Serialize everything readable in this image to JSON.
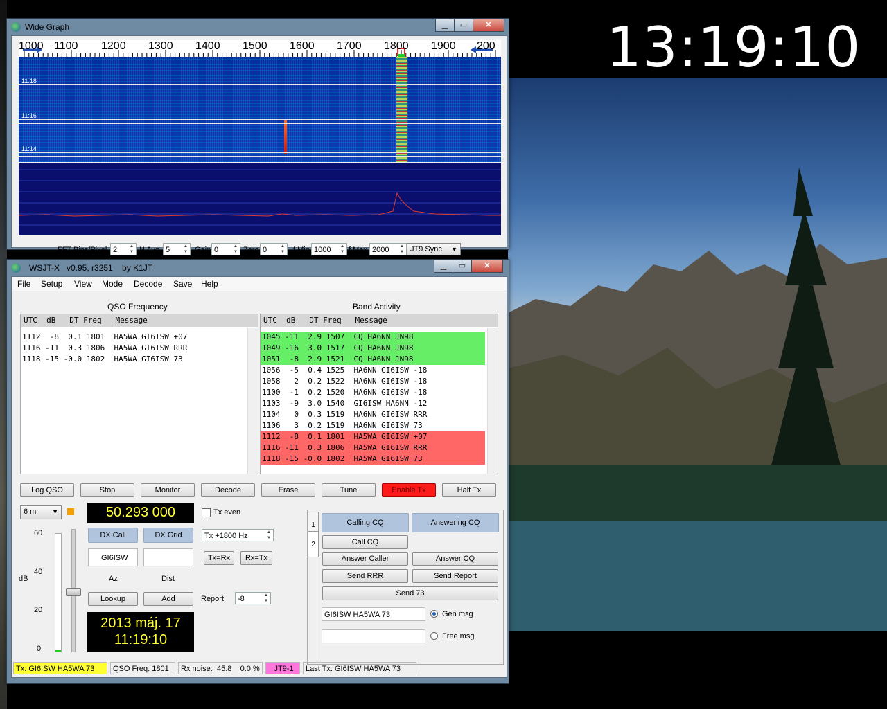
{
  "desktop": {
    "clock": "13:19:10"
  },
  "wide_graph": {
    "title": "Wide Graph",
    "freq_ticks": [
      "1000",
      "1100",
      "1200",
      "1300",
      "1400",
      "1500",
      "1600",
      "1700",
      "1800",
      "1900",
      "200"
    ],
    "wf_times": [
      "11:18",
      "11:16",
      "11:14"
    ],
    "controls": {
      "fft_label": "FFT Bins/Pixel",
      "fft_value": "2",
      "navg_label": "N Avg",
      "navg_value": "5",
      "gain_label": "Gain",
      "gain_value": "0",
      "zero_label": "Zero",
      "zero_value": "0",
      "fmin_label": "f Min",
      "fmin_value": "1000",
      "fmax_label": "f Max",
      "fmax_value": "2000",
      "mode_select": "JT9 Sync"
    }
  },
  "main": {
    "title": "WSJT-X   v0.95, r3251    by K1JT",
    "menu": [
      "File",
      "Setup",
      "View",
      "Mode",
      "Decode",
      "Save",
      "Help"
    ],
    "qso_title": "QSO Frequency",
    "band_title": "Band Activity",
    "list_header": "UTC  dB   DT Freq   Message",
    "qso_rows": [
      "1112  -8  0.1 1801  HA5WA GI6ISW +07",
      "1116 -11  0.3 1806  HA5WA GI6ISW RRR",
      "1118 -15 -0.0 1802  HA5WA GI6ISW 73"
    ],
    "band_rows": [
      {
        "text": "1045 -11  2.9 1507  CQ HA6NN JN98",
        "color": "#66ee66"
      },
      {
        "text": "1049 -16  3.0 1517  CQ HA6NN JN98",
        "color": "#66ee66"
      },
      {
        "text": "1051  -8  2.9 1521  CQ HA6NN JN98",
        "color": "#66ee66"
      },
      {
        "text": "1056  -5  0.4 1525  HA6NN GI6ISW -18",
        "color": "#ffffff"
      },
      {
        "text": "1058   2  0.2 1522  HA6NN GI6ISW -18",
        "color": "#ffffff"
      },
      {
        "text": "1100  -1  0.2 1520  HA6NN GI6ISW -18",
        "color": "#ffffff"
      },
      {
        "text": "1103  -9  3.0 1540  GI6ISW HA6NN -12",
        "color": "#ffffff"
      },
      {
        "text": "1104   0  0.3 1519  HA6NN GI6ISW RRR",
        "color": "#ffffff"
      },
      {
        "text": "1106   3  0.2 1519  HA6NN GI6ISW 73",
        "color": "#ffffff"
      },
      {
        "text": "1112  -8  0.1 1801  HA5WA GI6ISW +07",
        "color": "#ff6666"
      },
      {
        "text": "1116 -11  0.3 1806  HA5WA GI6ISW RRR",
        "color": "#ff6666"
      },
      {
        "text": "1118 -15 -0.0 1802  HA5WA GI6ISW 73",
        "color": "#ff6666"
      }
    ],
    "buttons": {
      "log_qso": "Log QSO",
      "stop": "Stop",
      "monitor": "Monitor",
      "decode": "Decode",
      "erase": "Erase",
      "tune": "Tune",
      "enable_tx": "Enable Tx",
      "halt_tx": "Halt Tx"
    },
    "band_select": "6 m",
    "dial_freq": "50.293 000",
    "tx_even_label": "Tx even",
    "dx_call_label": "DX Call",
    "dx_grid_label": "DX Grid",
    "dx_call_value": "GI6ISW",
    "tx_offset": "Tx +1800  Hz",
    "tx_eq_rx": "Tx=Rx",
    "rx_eq_tx": "Rx=Tx",
    "az_label": "Az",
    "dist_label": "Dist",
    "lookup": "Lookup",
    "add": "Add",
    "report_label": "Report",
    "report_value": "-8",
    "db_label": "dB",
    "meter_ticks": [
      "60",
      "40",
      "20",
      "0"
    ],
    "date_line1": "2013 máj. 17",
    "date_line2": "11:19:10",
    "tx_panel": {
      "tab1": "1",
      "tab2": "2",
      "calling_cq": "Calling CQ",
      "answering_cq": "Answering CQ",
      "call_cq": "Call CQ",
      "answer_caller": "Answer Caller",
      "answer_cq": "Answer CQ",
      "send_rrr": "Send RRR",
      "send_report": "Send Report",
      "send_73": "Send 73",
      "gen_msg_value": "GI6ISW HA5WA 73",
      "gen_msg_label": "Gen msg",
      "free_msg_value": "",
      "free_msg_label": "Free msg"
    },
    "status": {
      "tx": "Tx: GI6ISW HA5WA 73",
      "qso_freq": "QSO Freq:  1801",
      "rx_noise": "Rx noise:  45.8    0.0 %",
      "mode": "JT9-1",
      "last_tx": "Last Tx:  GI6ISW HA5WA 73"
    }
  },
  "colors": {
    "enable_tx": "#ff1a1a",
    "tx_status": "#ffff33",
    "mode_status": "#ff77dd",
    "qso_highlight": "#ff6666",
    "cq_highlight": "#66ee66"
  }
}
